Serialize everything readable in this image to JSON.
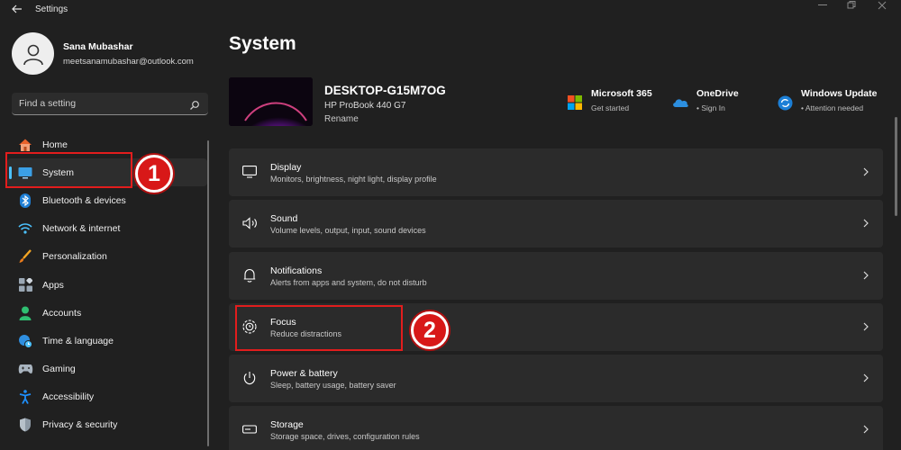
{
  "window": {
    "title": "Settings"
  },
  "user": {
    "name": "Sana Mubashar",
    "email": "meetsanamubashar@outlook.com"
  },
  "search": {
    "placeholder": "Find a setting"
  },
  "sidebar": {
    "items": [
      {
        "label": "Home",
        "icon": "home-icon"
      },
      {
        "label": "System",
        "icon": "monitor-icon",
        "active": true
      },
      {
        "label": "Bluetooth & devices",
        "icon": "bluetooth-icon"
      },
      {
        "label": "Network & internet",
        "icon": "wifi-icon"
      },
      {
        "label": "Personalization",
        "icon": "brush-icon"
      },
      {
        "label": "Apps",
        "icon": "apps-icon"
      },
      {
        "label": "Accounts",
        "icon": "person-icon"
      },
      {
        "label": "Time & language",
        "icon": "globe-clock-icon"
      },
      {
        "label": "Gaming",
        "icon": "gamepad-icon"
      },
      {
        "label": "Accessibility",
        "icon": "accessibility-icon"
      },
      {
        "label": "Privacy & security",
        "icon": "shield-icon"
      }
    ]
  },
  "main": {
    "title": "System",
    "device": {
      "name": "DESKTOP-G15M7OG",
      "model": "HP ProBook 440 G7",
      "rename_label": "Rename"
    },
    "quick": [
      {
        "title": "Microsoft 365",
        "sub": "Get started",
        "icon": "microsoft-logo-icon"
      },
      {
        "title": "OneDrive",
        "sub": "•  Sign In",
        "icon": "cloud-icon"
      },
      {
        "title": "Windows Update",
        "sub": "•  Attention needed",
        "icon": "sync-icon"
      }
    ],
    "cards": [
      {
        "title": "Display",
        "sub": "Monitors, brightness, night light, display profile",
        "icon": "display-icon"
      },
      {
        "title": "Sound",
        "sub": "Volume levels, output, input, sound devices",
        "icon": "speaker-icon"
      },
      {
        "title": "Notifications",
        "sub": "Alerts from apps and system, do not disturb",
        "icon": "bell-icon"
      },
      {
        "title": "Focus",
        "sub": "Reduce distractions",
        "icon": "focus-icon"
      },
      {
        "title": "Power & battery",
        "sub": "Sleep, battery usage, battery saver",
        "icon": "power-icon"
      },
      {
        "title": "Storage",
        "sub": "Storage space, drives, configuration rules",
        "icon": "storage-icon"
      }
    ]
  },
  "annotations": [
    {
      "label": "1"
    },
    {
      "label": "2"
    }
  ],
  "colors": {
    "accent": "#4cc2ff",
    "annotation": "#e21d1d",
    "background": "#202020",
    "card": "#2b2b2b"
  }
}
